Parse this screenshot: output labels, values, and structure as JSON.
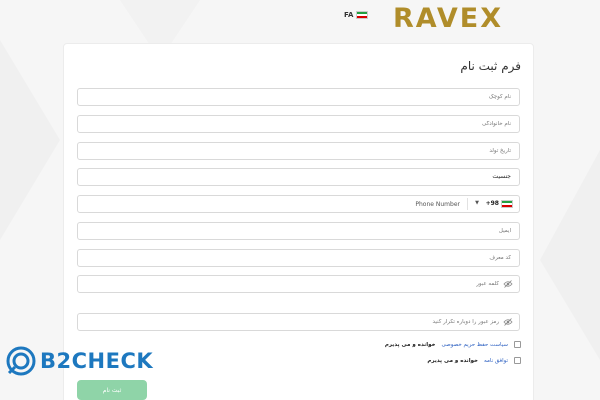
{
  "header": {
    "logo_text": "RAVEX",
    "language": "FA",
    "language_flag": "iran-flag-icon"
  },
  "form": {
    "title": "فرم ثبت نام",
    "fields": {
      "first_name_placeholder": "نام کوچک",
      "last_name_placeholder": "نام خانوادگی",
      "birth_date_placeholder": "تاریخ تولد",
      "gender_value": "جنسیت",
      "phone_code": "+98",
      "phone_placeholder": "Phone Number",
      "email_placeholder": "ایمیل",
      "referral_placeholder": "کد معرف",
      "password_placeholder": "کلمه عبور",
      "password_confirm_placeholder": "رمز عبور را دوباره تکرار کنید"
    },
    "agreements": {
      "privacy_link": "سیاست حفظ حریم خصوصی",
      "privacy_text": "خوانده و می پذیرم",
      "terms_link": "توافق نامه",
      "terms_text": "خوانده و می پذیرم"
    },
    "submit_label": "ثبت نام"
  },
  "watermark": {
    "text": "B2CHECK"
  },
  "colors": {
    "accent_gold": "#b08d2a",
    "link_blue": "#2f62c2",
    "submit_green": "#8fd4a8",
    "watermark_blue": "#1d78bf"
  }
}
